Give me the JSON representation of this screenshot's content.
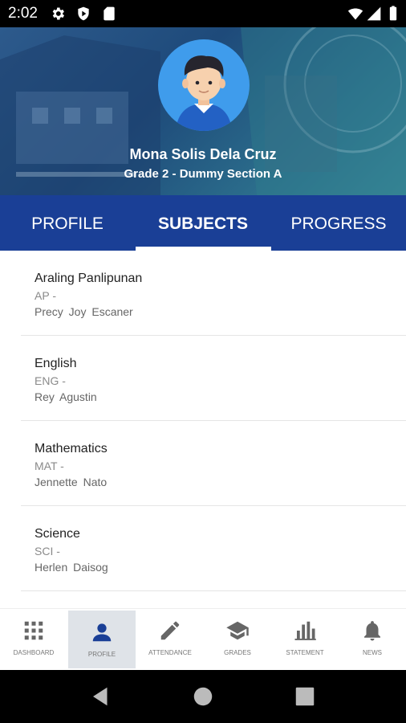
{
  "status_bar": {
    "time": "2:02"
  },
  "student": {
    "name": "Mona Solis Dela Cruz",
    "grade_section": "Grade 2 - Dummy Section A"
  },
  "tabs": [
    {
      "label": "PROFILE",
      "active": false
    },
    {
      "label": "SUBJECTS",
      "active": true
    },
    {
      "label": "PROGRESS",
      "active": false
    }
  ],
  "subjects": [
    {
      "name": "Araling Panlipunan",
      "code": "AP -",
      "teacher": "Precy Joy  Escaner"
    },
    {
      "name": "English",
      "code": "ENG -",
      "teacher": "Rey  Agustin"
    },
    {
      "name": "Mathematics",
      "code": "MAT -",
      "teacher": "Jennette  Nato"
    },
    {
      "name": "Science",
      "code": "SCI -",
      "teacher": "Herlen  Daisog"
    }
  ],
  "bottom_nav": [
    {
      "label": "DASHBOARD",
      "icon": "grid-icon"
    },
    {
      "label": "PROFILE",
      "icon": "person-icon",
      "active": true
    },
    {
      "label": "ATTENDANCE",
      "icon": "pencil-icon"
    },
    {
      "label": "GRADES",
      "icon": "graduation-cap-icon"
    },
    {
      "label": "STATEMENT",
      "icon": "bar-chart-icon"
    },
    {
      "label": "NEWS",
      "icon": "bell-icon"
    }
  ],
  "colors": {
    "tab_bar": "#1a3f96",
    "avatar_bg": "#3f9cec",
    "nav_active_bg": "#dfe3e8"
  }
}
